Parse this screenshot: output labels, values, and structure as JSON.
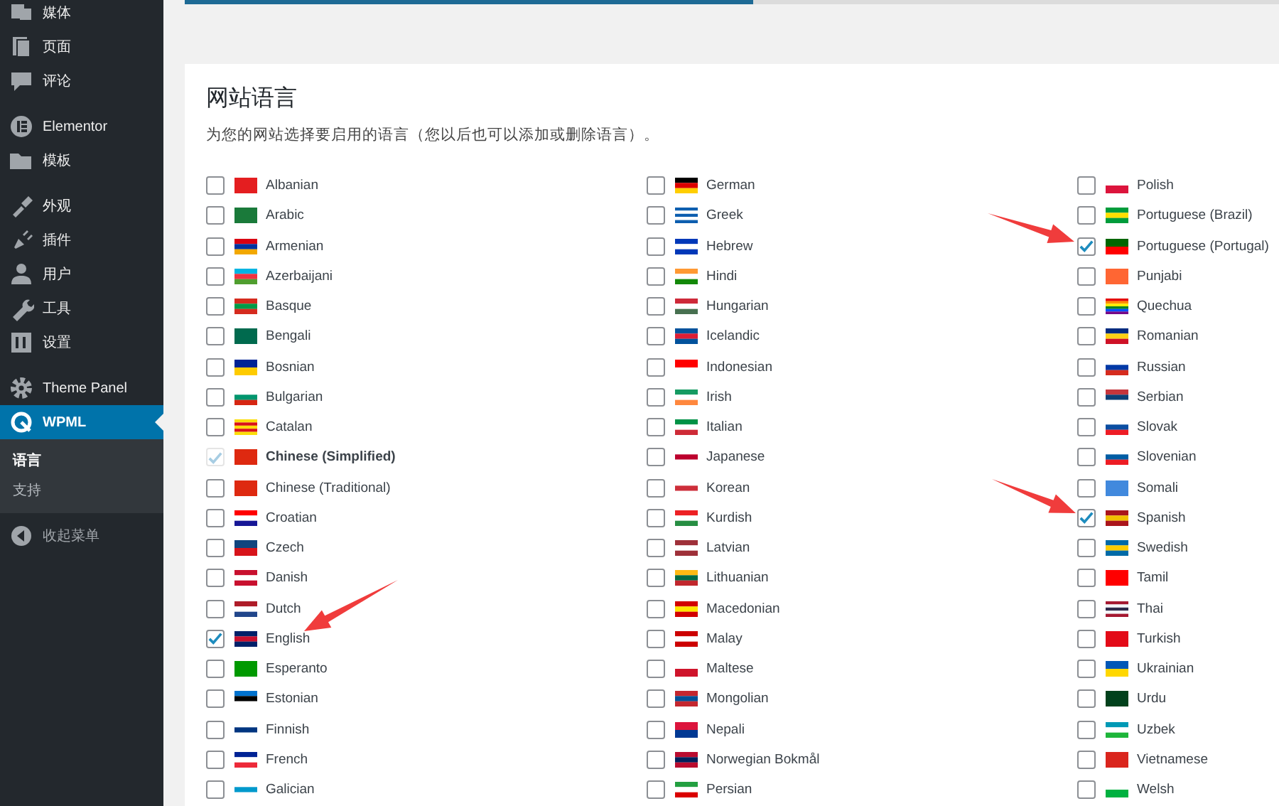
{
  "sidebar": {
    "groups": [
      {
        "items": [
          {
            "label": "媒体",
            "selected": false
          },
          {
            "label": "页面",
            "selected": false
          },
          {
            "label": "评论",
            "selected": false
          }
        ]
      },
      {
        "items": [
          {
            "label": "Elementor",
            "selected": false
          },
          {
            "label": "模板",
            "selected": false
          }
        ]
      },
      {
        "items": [
          {
            "label": "外观",
            "selected": false
          },
          {
            "label": "插件",
            "selected": false
          },
          {
            "label": "用户",
            "selected": false
          },
          {
            "label": "工具",
            "selected": false
          },
          {
            "label": "设置",
            "selected": false
          }
        ]
      },
      {
        "items": [
          {
            "label": "Theme Panel",
            "selected": false
          },
          {
            "label": "WPML",
            "selected": true,
            "children": [
              {
                "label": "语言",
                "selected": true
              },
              {
                "label": "支持",
                "selected": false
              }
            ]
          }
        ]
      }
    ],
    "collapse": "收起菜单"
  },
  "wizard": {
    "level": 0.52
  },
  "section": {
    "title": "网站语言",
    "description": "为您的网站选择要启用的语言（您以后也可以添加或删除语言）。",
    "columns": [
      [
        {
          "label": "Albanian",
          "checked": false,
          "disabled": false
        },
        {
          "label": "Arabic",
          "checked": false,
          "disabled": false
        },
        {
          "label": "Armenian",
          "checked": false,
          "disabled": false
        },
        {
          "label": "Azerbaijani",
          "checked": false,
          "disabled": false
        },
        {
          "label": "Basque",
          "checked": false,
          "disabled": false
        },
        {
          "label": "Bengali",
          "checked": false,
          "disabled": false
        },
        {
          "label": "Bosnian",
          "checked": false,
          "disabled": false
        },
        {
          "label": "Bulgarian",
          "checked": false,
          "disabled": false
        },
        {
          "label": "Catalan",
          "checked": false,
          "disabled": false
        },
        {
          "label": "Chinese (Simplified)",
          "checked": true,
          "disabled": true
        },
        {
          "label": "Chinese (Traditional)",
          "checked": false,
          "disabled": false
        },
        {
          "label": "Croatian",
          "checked": false,
          "disabled": false
        },
        {
          "label": "Czech",
          "checked": false,
          "disabled": false
        },
        {
          "label": "Danish",
          "checked": false,
          "disabled": false
        },
        {
          "label": "Dutch",
          "checked": false,
          "disabled": false
        },
        {
          "label": "English",
          "checked": true,
          "disabled": false
        },
        {
          "label": "Esperanto",
          "checked": false,
          "disabled": false
        },
        {
          "label": "Estonian",
          "checked": false,
          "disabled": false
        },
        {
          "label": "Finnish",
          "checked": false,
          "disabled": false
        },
        {
          "label": "French",
          "checked": false,
          "disabled": false
        },
        {
          "label": "Galician",
          "checked": false,
          "disabled": false
        }
      ],
      [
        {
          "label": "German",
          "checked": false,
          "disabled": false
        },
        {
          "label": "Greek",
          "checked": false,
          "disabled": false
        },
        {
          "label": "Hebrew",
          "checked": false,
          "disabled": false
        },
        {
          "label": "Hindi",
          "checked": false,
          "disabled": false
        },
        {
          "label": "Hungarian",
          "checked": false,
          "disabled": false
        },
        {
          "label": "Icelandic",
          "checked": false,
          "disabled": false
        },
        {
          "label": "Indonesian",
          "checked": false,
          "disabled": false
        },
        {
          "label": "Irish",
          "checked": false,
          "disabled": false
        },
        {
          "label": "Italian",
          "checked": false,
          "disabled": false
        },
        {
          "label": "Japanese",
          "checked": false,
          "disabled": false
        },
        {
          "label": "Korean",
          "checked": false,
          "disabled": false
        },
        {
          "label": "Kurdish",
          "checked": false,
          "disabled": false
        },
        {
          "label": "Latvian",
          "checked": false,
          "disabled": false
        },
        {
          "label": "Lithuanian",
          "checked": false,
          "disabled": false
        },
        {
          "label": "Macedonian",
          "checked": false,
          "disabled": false
        },
        {
          "label": "Malay",
          "checked": false,
          "disabled": false
        },
        {
          "label": "Maltese",
          "checked": false,
          "disabled": false
        },
        {
          "label": "Mongolian",
          "checked": false,
          "disabled": false
        },
        {
          "label": "Nepali",
          "checked": false,
          "disabled": false
        },
        {
          "label": "Norwegian Bokmål",
          "checked": false,
          "disabled": false
        },
        {
          "label": "Persian",
          "checked": false,
          "disabled": false
        }
      ],
      [
        {
          "label": "Polish",
          "checked": false,
          "disabled": false
        },
        {
          "label": "Portuguese (Brazil)",
          "checked": false,
          "disabled": false
        },
        {
          "label": "Portuguese (Portugal)",
          "checked": true,
          "disabled": false
        },
        {
          "label": "Punjabi",
          "checked": false,
          "disabled": false
        },
        {
          "label": "Quechua",
          "checked": false,
          "disabled": false
        },
        {
          "label": "Romanian",
          "checked": false,
          "disabled": false
        },
        {
          "label": "Russian",
          "checked": false,
          "disabled": false
        },
        {
          "label": "Serbian",
          "checked": false,
          "disabled": false
        },
        {
          "label": "Slovak",
          "checked": false,
          "disabled": false
        },
        {
          "label": "Slovenian",
          "checked": false,
          "disabled": false
        },
        {
          "label": "Somali",
          "checked": false,
          "disabled": false
        },
        {
          "label": "Spanish",
          "checked": true,
          "disabled": false
        },
        {
          "label": "Swedish",
          "checked": false,
          "disabled": false
        },
        {
          "label": "Tamil",
          "checked": false,
          "disabled": false
        },
        {
          "label": "Thai",
          "checked": false,
          "disabled": false
        },
        {
          "label": "Turkish",
          "checked": false,
          "disabled": false
        },
        {
          "label": "Ukrainian",
          "checked": false,
          "disabled": false
        },
        {
          "label": "Urdu",
          "checked": false,
          "disabled": false
        },
        {
          "label": "Uzbek",
          "checked": false,
          "disabled": false
        },
        {
          "label": "Vietnamese",
          "checked": false,
          "disabled": false
        },
        {
          "label": "Welsh",
          "checked": false,
          "disabled": false
        }
      ]
    ]
  }
}
